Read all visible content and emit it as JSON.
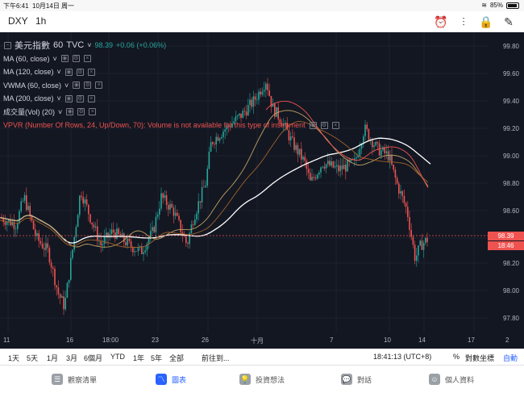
{
  "status": {
    "time": "下午6:41",
    "date": "10月14日 周一",
    "battery": "85%"
  },
  "header": {
    "symbol": "DXY",
    "interval": "1h"
  },
  "legend": {
    "title": "美元指數",
    "interval": "60",
    "source": "TVC",
    "price": "98.39",
    "change": "+0.06 (+0.06%)",
    "indicators": [
      "MA (60, close)",
      "MA (120, close)",
      "VWMA (60, close)",
      "MA (200, close)",
      "成交量(Vol) (20)"
    ],
    "vpvr": "VPVR (Number Of Rows, 24, Up/Down, 70): Volume is not available for this type of instrument"
  },
  "price_axis": [
    "99.80",
    "99.60",
    "99.40",
    "99.20",
    "99.00",
    "98.80",
    "98.60",
    "98.20",
    "98.00",
    "97.80"
  ],
  "price_tags": {
    "last": "98.39",
    "countdown": "18:46"
  },
  "time_axis": [
    "11",
    "16",
    "18:00",
    "23",
    "26",
    "十月",
    "7",
    "10",
    "14",
    "17",
    "2"
  ],
  "range_bar": {
    "ranges": [
      "1天",
      "5天",
      "1月",
      "3月",
      "6個月",
      "YTD",
      "1年",
      "5年",
      "全部"
    ],
    "goto": "前往到...",
    "clock": "18:41:13 (UTC+8)",
    "percent": "%",
    "log": "對數坐標",
    "auto": "自動"
  },
  "tabs": [
    {
      "label": "觀察清單",
      "icon": "list-icon"
    },
    {
      "label": "圖表",
      "icon": "chart-icon"
    },
    {
      "label": "投資想法",
      "icon": "idea-icon"
    },
    {
      "label": "對話",
      "icon": "chat-icon"
    },
    {
      "label": "個人資料",
      "icon": "profile-icon"
    }
  ],
  "colors": {
    "bg": "#131722",
    "up": "#26a69a",
    "down": "#ef5350",
    "ma60": "#ef5350",
    "ma120": "#ffffff",
    "vwma": "#c0a060",
    "ma200": "#a0622a",
    "accent": "#2962ff"
  }
}
